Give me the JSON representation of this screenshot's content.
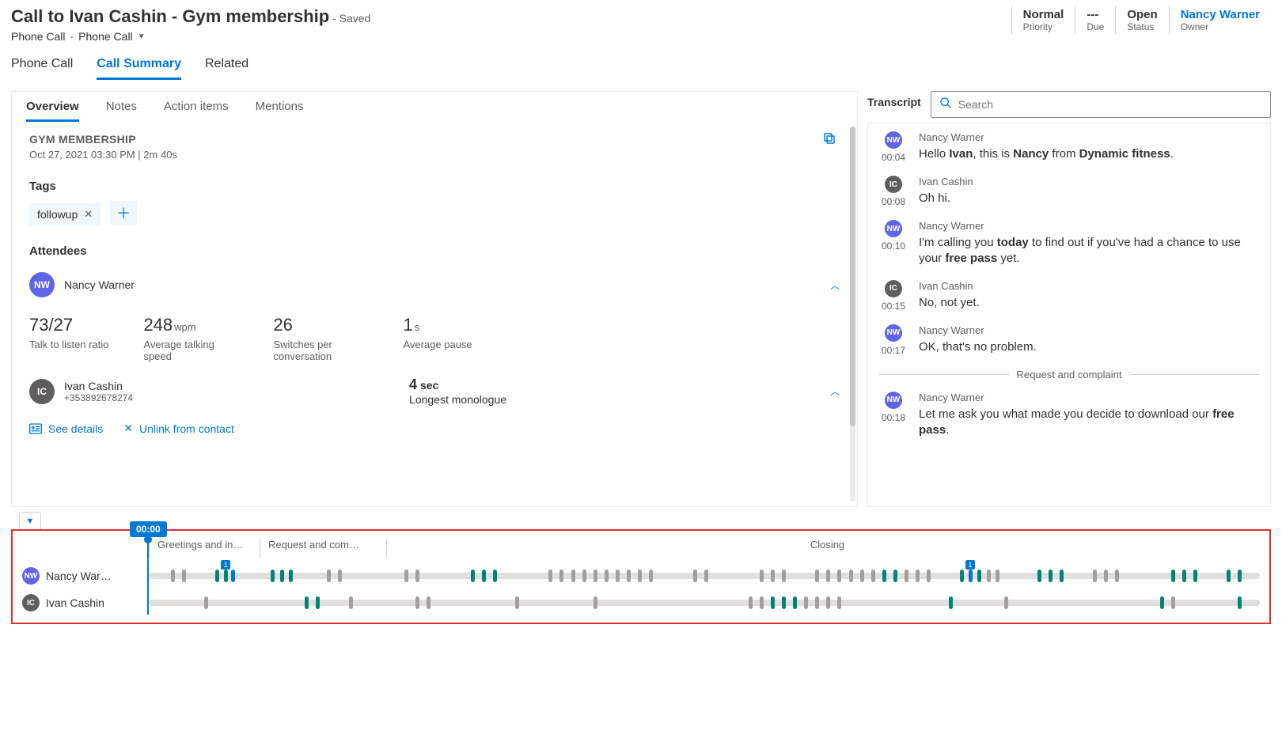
{
  "header": {
    "title": "Call to Ivan Cashin - Gym membership",
    "saved": "- Saved",
    "breadcrumb1": "Phone Call",
    "breadcrumb_sep": "·",
    "breadcrumb2": "Phone Call"
  },
  "info": {
    "priority": {
      "value": "Normal",
      "label": "Priority"
    },
    "due": {
      "value": "---",
      "label": "Due"
    },
    "status": {
      "value": "Open",
      "label": "Status"
    },
    "owner": {
      "value": "Nancy Warner",
      "label": "Owner"
    }
  },
  "main_tabs": {
    "t1": "Phone Call",
    "t2": "Call Summary",
    "t3": "Related"
  },
  "subtabs": {
    "t1": "Overview",
    "t2": "Notes",
    "t3": "Action items",
    "t4": "Mentions"
  },
  "overview": {
    "title": "GYM MEMBERSHIP",
    "meta": "Oct 27, 2021 03:30 PM  |  2m 40s",
    "tags_label": "Tags",
    "tag1": "followup",
    "attendees_label": "Attendees",
    "att1_name": "Nancy Warner",
    "stats": {
      "ratio": {
        "v": "73/27",
        "c": "Talk to listen ratio"
      },
      "wpm": {
        "v": "248",
        "u": "wpm",
        "c": "Average talking speed"
      },
      "sw": {
        "v": "26",
        "c": "Switches per conversation"
      },
      "pause": {
        "v": "1",
        "u": "s",
        "c": "Average pause"
      }
    },
    "att2_name": "Ivan Cashin",
    "att2_sub": "+353892678274",
    "mono": {
      "v": "4",
      "u": "sec",
      "c": "Longest monologue"
    },
    "see_details": "See details",
    "unlink": "Unlink from contact"
  },
  "right": {
    "tab": "Transcript",
    "search_ph": "Search"
  },
  "transcript": [
    {
      "avatar": "nw",
      "init": "NW",
      "ts": "00:04",
      "spk": "Nancy Warner",
      "html": "Hello <b>Ivan</b>, this is <b>Nancy</b> from <b>Dynamic fitness</b>."
    },
    {
      "avatar": "ic",
      "init": "IC",
      "ts": "00:08",
      "spk": "Ivan Cashin",
      "html": "Oh hi."
    },
    {
      "avatar": "nw",
      "init": "NW",
      "ts": "00:10",
      "spk": "Nancy Warner",
      "html": "I'm calling you <b>today</b> to find out if you've had a chance to use your <b>free pass</b> yet."
    },
    {
      "avatar": "ic",
      "init": "IC",
      "ts": "00:15",
      "spk": "Ivan Cashin",
      "html": "No, not yet."
    },
    {
      "avatar": "nw",
      "init": "NW",
      "ts": "00:17",
      "spk": "Nancy Warner",
      "html": "OK, that's no problem."
    }
  ],
  "t_divider": "Request and complaint",
  "transcript2": [
    {
      "avatar": "nw",
      "init": "NW",
      "ts": "00:18",
      "spk": "Nancy Warner",
      "html": "Let me ask you what made you decide to download our <b>free pass</b>."
    }
  ],
  "timeline": {
    "time": "00:00",
    "seg1": "Greetings and in…",
    "seg2": "Request and com…",
    "seg3": "Closing",
    "track1_name": "Nancy War…",
    "track2_name": "Ivan Cashin",
    "marker": "1"
  }
}
